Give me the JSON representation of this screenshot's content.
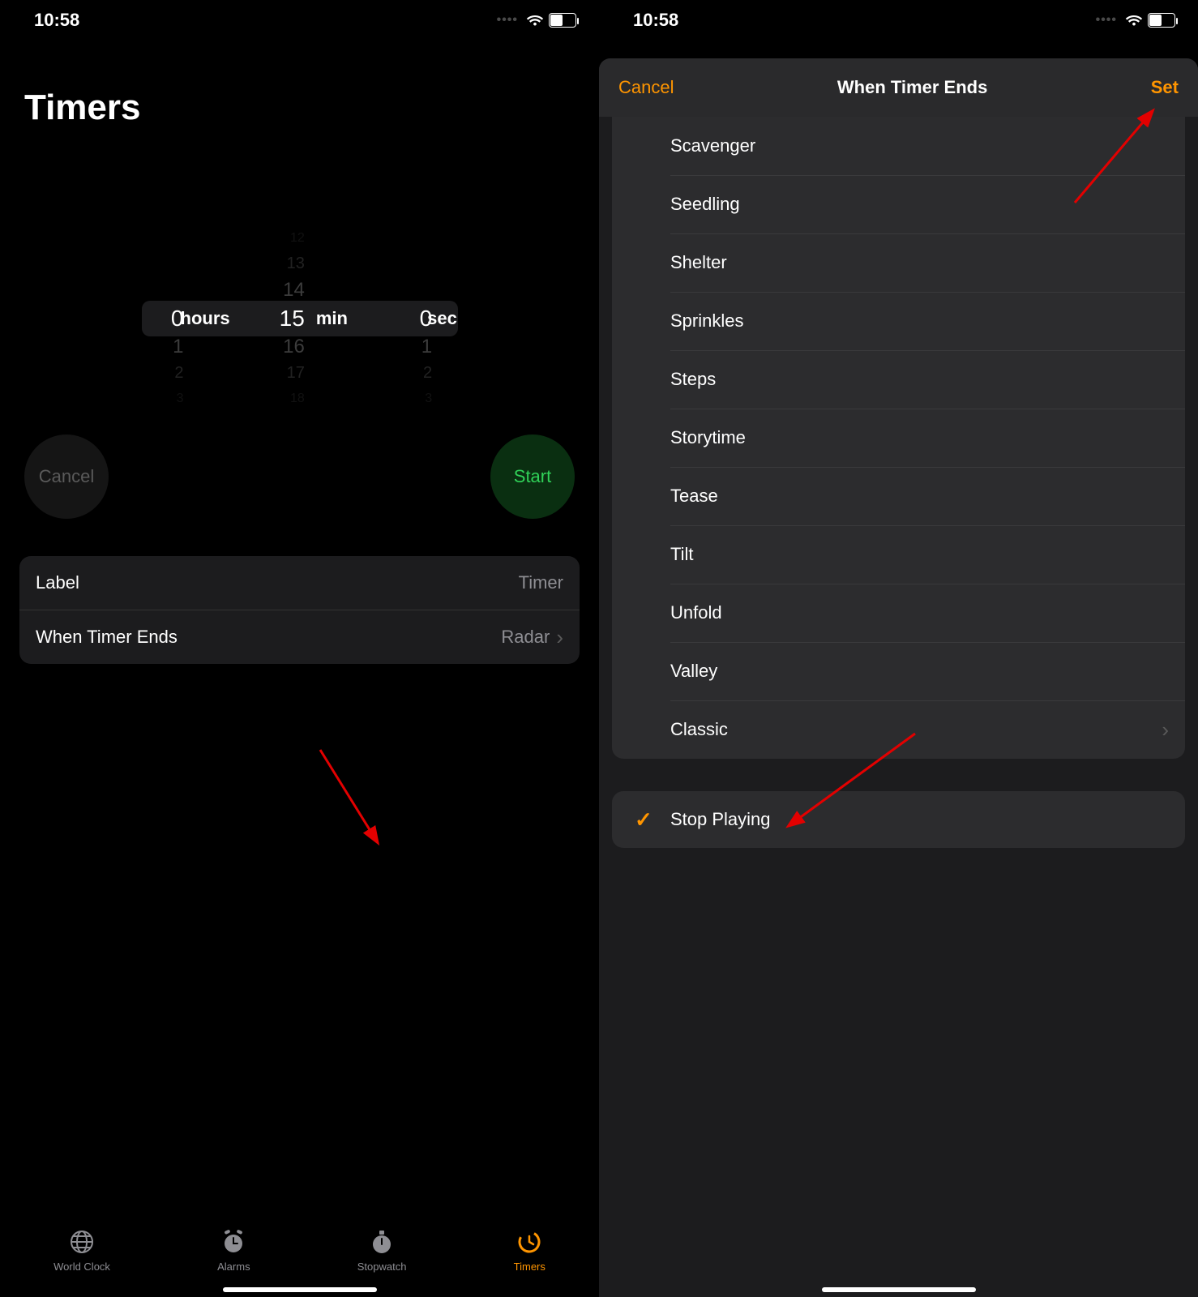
{
  "status": {
    "time": "10:58",
    "battery_pct": "47"
  },
  "left": {
    "title": "Timers",
    "picker": {
      "hours": {
        "sel": "0",
        "below": [
          "1",
          "2",
          "3"
        ],
        "unit": "hours"
      },
      "min": {
        "above": [
          "12",
          "13",
          "14"
        ],
        "sel": "15",
        "below": [
          "16",
          "17",
          "18"
        ],
        "unit": "min"
      },
      "sec": {
        "sel": "0",
        "below": [
          "1",
          "2",
          "3"
        ],
        "unit": "sec"
      }
    },
    "cancel": "Cancel",
    "start": "Start",
    "settings": {
      "label_title": "Label",
      "label_value": "Timer",
      "ends_title": "When Timer Ends",
      "ends_value": "Radar"
    },
    "tabs": {
      "world": "World Clock",
      "alarms": "Alarms",
      "stopwatch": "Stopwatch",
      "timers": "Timers"
    }
  },
  "right": {
    "cancel": "Cancel",
    "title": "When Timer Ends",
    "set": "Set",
    "sounds": [
      "Scavenger",
      "Seedling",
      "Shelter",
      "Sprinkles",
      "Steps",
      "Storytime",
      "Tease",
      "Tilt",
      "Unfold",
      "Valley",
      "Classic"
    ],
    "stop_playing": "Stop Playing"
  }
}
